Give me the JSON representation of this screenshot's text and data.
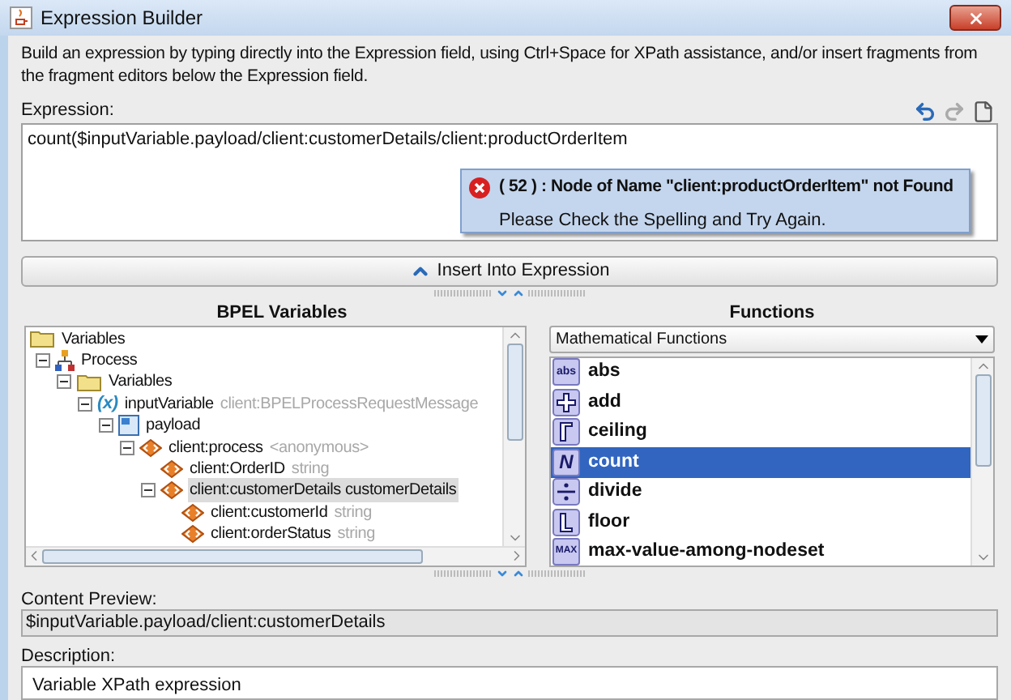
{
  "window": {
    "title": "Expression Builder"
  },
  "instructions": "Build an expression by typing directly into the Expression field, using Ctrl+Space for XPath assistance, and/or insert fragments from the fragment editors below the Expression field.",
  "expression": {
    "label": "Expression:",
    "value": "count($inputVariable.payload/client:customerDetails/client:productOrderItem"
  },
  "error_popup": {
    "title": "( 52 ) : Node of Name \"client:productOrderItem\" not Found",
    "message": "Please Check the Spelling and Try Again."
  },
  "insert_button": "Insert Into Expression",
  "bpel_variables": {
    "title": "BPEL Variables",
    "tree": [
      {
        "name": "Variables",
        "kind": "folder",
        "selected": false,
        "children": [
          {
            "name": "Process",
            "kind": "process",
            "expanded": true,
            "selected": false,
            "children": [
              {
                "name": "Variables",
                "kind": "folder",
                "expanded": true,
                "selected": false,
                "children": [
                  {
                    "name": "inputVariable",
                    "type": "client:BPELProcessRequestMessage",
                    "kind": "variable",
                    "icon": "(x)",
                    "expanded": true,
                    "selected": false,
                    "children": [
                      {
                        "name": "payload",
                        "kind": "message",
                        "expanded": true,
                        "selected": false,
                        "children": [
                          {
                            "name": "client:process",
                            "type": "<anonymous>",
                            "kind": "element",
                            "expanded": true,
                            "selected": false,
                            "children": [
                              {
                                "name": "client:OrderID",
                                "type": "string",
                                "kind": "element",
                                "selected": false
                              },
                              {
                                "name": "client:customerDetails customerDetails",
                                "kind": "element",
                                "expanded": true,
                                "selected": true,
                                "children": [
                                  {
                                    "name": "client:customerId",
                                    "type": "string",
                                    "kind": "element",
                                    "selected": false
                                  },
                                  {
                                    "name": "client:orderStatus",
                                    "type": "string",
                                    "kind": "element",
                                    "selected": false
                                  }
                                ]
                              }
                            ]
                          }
                        ]
                      }
                    ]
                  }
                ]
              }
            ]
          }
        ]
      }
    ]
  },
  "functions": {
    "title": "Functions",
    "category": "Mathematical Functions",
    "items": [
      {
        "name": "abs",
        "kind": "abs",
        "icon": "abs",
        "selected": false
      },
      {
        "name": "add",
        "kind": "add",
        "selected": false
      },
      {
        "name": "ceiling",
        "kind": "ceiling",
        "selected": false
      },
      {
        "name": "count",
        "kind": "count",
        "icon": "N",
        "selected": true
      },
      {
        "name": "divide",
        "kind": "divide",
        "selected": false
      },
      {
        "name": "floor",
        "kind": "floor",
        "selected": false
      },
      {
        "name": "max-value-among-nodeset",
        "kind": "max",
        "icon": "MAX",
        "selected": false
      }
    ]
  },
  "content_preview": {
    "label": "Content Preview:",
    "value": "$inputVariable.payload/client:customerDetails"
  },
  "description": {
    "label": "Description:",
    "text": "Variable XPath expression"
  }
}
